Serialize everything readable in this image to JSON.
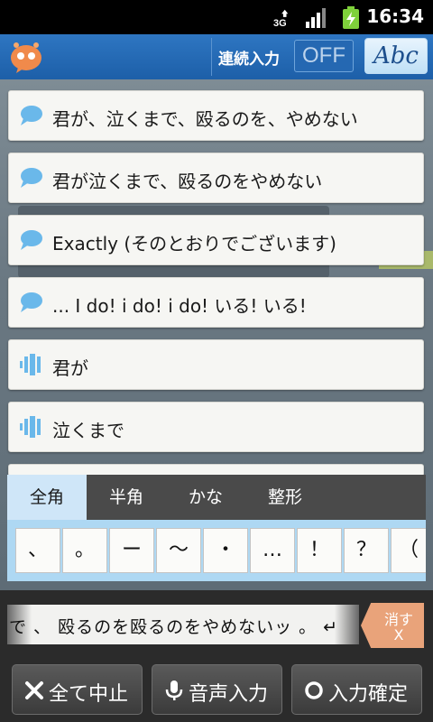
{
  "status_bar": {
    "network": "3G",
    "time": "16:34",
    "icons": [
      "3g-data-icon",
      "signal-icon",
      "battery-charging-icon"
    ]
  },
  "app_bar": {
    "logo": "speech-bubble-logo",
    "continuous_input_label": "連続入力",
    "toggle_value": "OFF",
    "mode_button": "Abc"
  },
  "candidates": [
    {
      "text": "君が、泣くまで、殴るのを、やめない",
      "icon": "speech-bubble-icon"
    },
    {
      "text": "君が泣くまで、殴るのをやめない",
      "icon": "speech-bubble-icon"
    },
    {
      "text": "Exactly (そのとおりでございます)",
      "icon": "speech-bubble-icon"
    },
    {
      "text": "... I do! i do! i do! いる! いる!",
      "icon": "speech-bubble-icon"
    },
    {
      "text": "君が",
      "icon": "sound-wave-icon"
    },
    {
      "text": "泣くまで",
      "icon": "sound-wave-icon"
    }
  ],
  "keyboard": {
    "tabs": [
      "全角",
      "半角",
      "かな",
      "整形"
    ],
    "active_tab": "全角",
    "keys": [
      "、",
      "。",
      "ー",
      "〜",
      "・",
      "…",
      "！",
      "？",
      "（"
    ]
  },
  "compose": {
    "text": "で 、 殴るのを殴るのをやめないッ 。 ↵",
    "delete_label_line1": "消す",
    "delete_label_line2": "X"
  },
  "actions": {
    "cancel_all": "全て中止",
    "voice_input": "音声入力",
    "confirm_input": "入力確定"
  },
  "colors": {
    "app_bar": "#2e76c2",
    "active_tab": "#cfe6f8",
    "delete_button": "#e9a37a",
    "bubble": "#6ab8ea"
  }
}
